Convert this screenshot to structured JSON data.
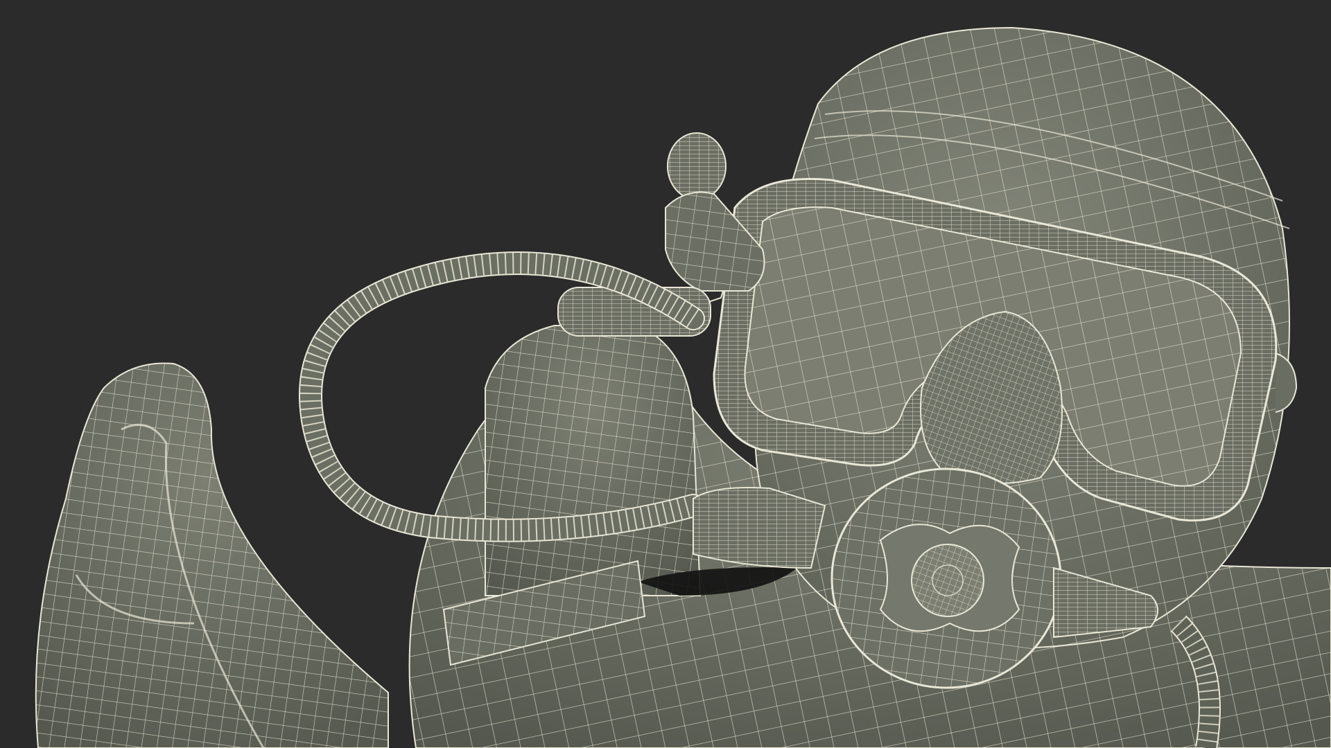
{
  "scene": {
    "subject": "scuba-diver-wireframe-render",
    "background_color": "#2b2b2b",
    "surface_color": "#777a6e",
    "surface_dark_color": "#5e6156",
    "wire_color": "#e9e7d6"
  }
}
